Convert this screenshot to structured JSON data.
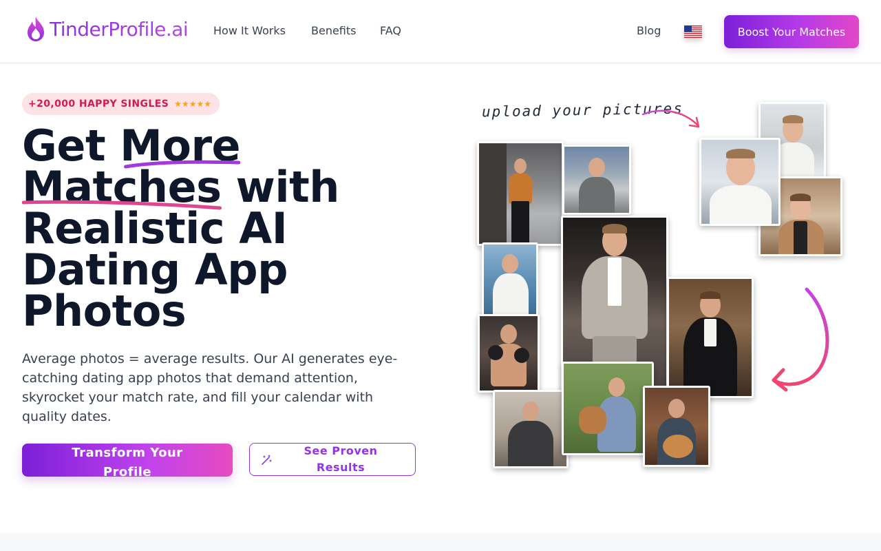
{
  "header": {
    "logo_text": "TinderProfile.ai",
    "nav": [
      "How It Works",
      "Benefits",
      "FAQ"
    ],
    "blog": "Blog",
    "language_flag": "us-flag-icon",
    "cta": "Boost Your Matches"
  },
  "hero": {
    "badge": "+20,000 HAPPY SINGLES",
    "rating_stars": "★★★★★",
    "headline": {
      "line1_a": "Get ",
      "line1_b": "More",
      "line2_a": "Matches",
      "line2_b": " with",
      "line3": "Realistic AI",
      "line4": "Dating App",
      "line5": "Photos"
    },
    "subtext": "Average photos = average results. Our AI generates eye-catching dating app photos that demand attention, skyrocket your match rate, and fill your calendar with quality dates.",
    "primary_button": "Transform Your Profile",
    "secondary_button": "See Proven Results",
    "upload_label": "upload your pictures"
  },
  "colors": {
    "brand_purple": "#9333ea",
    "brand_pink": "#e248c8",
    "badge_bg": "#fde2e6",
    "badge_text": "#d21c4e",
    "star": "#f5a517",
    "headline": "#0f172a"
  }
}
